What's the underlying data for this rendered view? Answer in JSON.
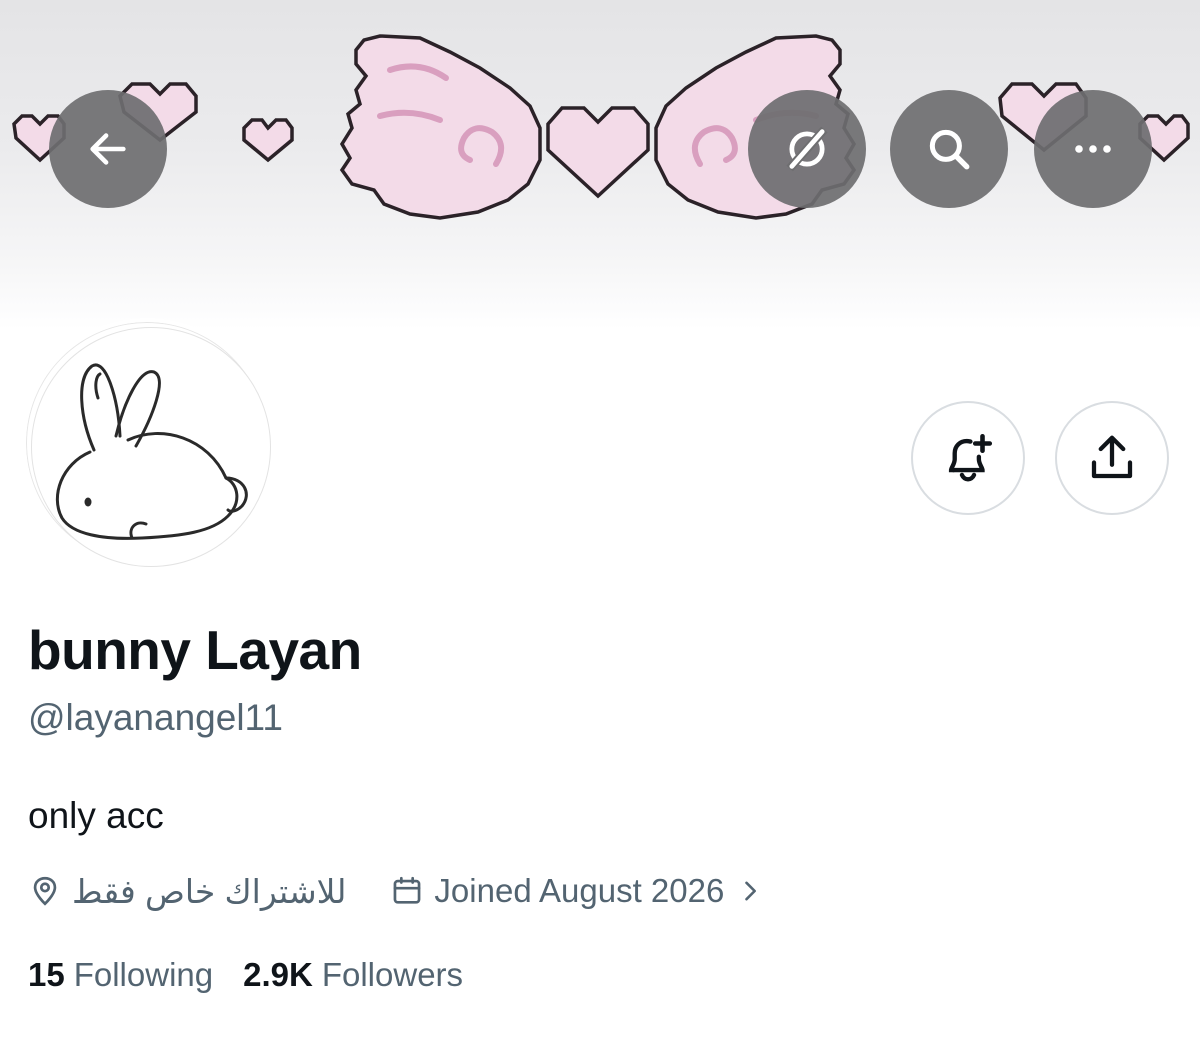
{
  "header": {
    "back_icon": "arrow-left-icon",
    "grok_icon": "grok-icon",
    "search_icon": "search-icon",
    "more_icon": "more-horizontal-icon"
  },
  "actions": {
    "notify_icon": "bell-plus-icon",
    "share_icon": "share-upload-icon"
  },
  "profile": {
    "display_name": "bunny Layan",
    "handle": "@layanangel11",
    "bio": "only acc",
    "location": "للاشتراك خاص فقط",
    "joined": "Joined August 2026",
    "following_count": "15",
    "following_label": "Following",
    "followers_count": "2.9K",
    "followers_label": "Followers"
  },
  "colors": {
    "text_primary": "#0f1419",
    "text_secondary": "#536471",
    "overlay_button": "#6e6e70",
    "banner_pink": "#f2d6e6"
  }
}
